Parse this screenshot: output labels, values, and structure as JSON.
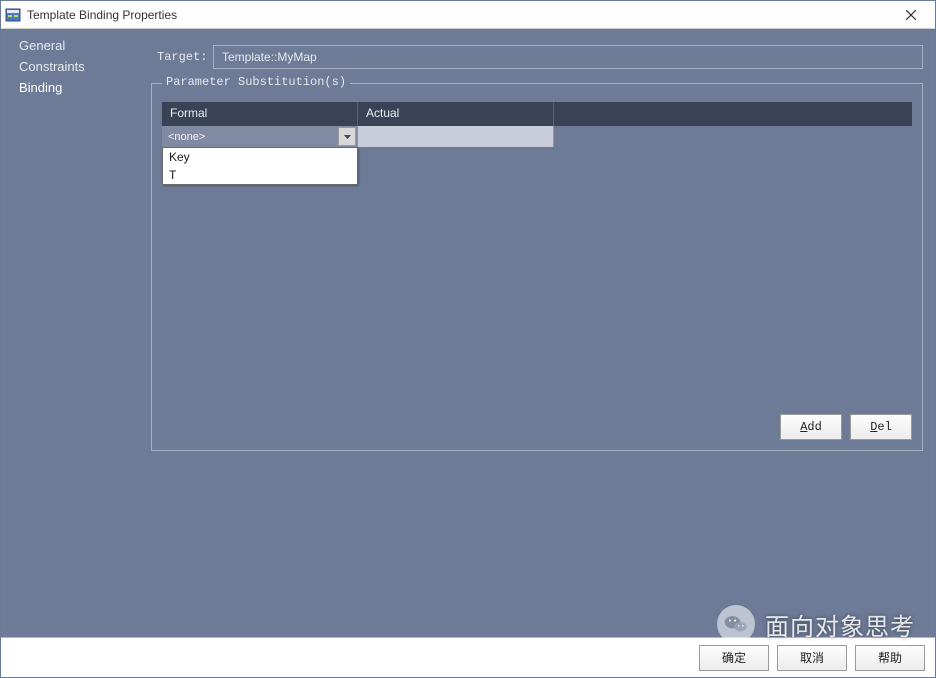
{
  "window": {
    "title": "Template Binding Properties"
  },
  "sidebar": {
    "items": [
      {
        "label": "General",
        "selected": false
      },
      {
        "label": "Constraints",
        "selected": false
      },
      {
        "label": "Binding",
        "selected": true
      }
    ]
  },
  "content": {
    "target_label": "Target:",
    "target_value": "Template::MyMap",
    "group_title": "Parameter Substitution(s)",
    "columns": {
      "formal": "Formal",
      "actual": "Actual"
    },
    "row": {
      "formal_value": "<none>",
      "actual_value": ""
    },
    "dropdown_options": [
      "Key",
      "T"
    ],
    "buttons": {
      "add_prefix": "A",
      "add_rest": "dd",
      "del_prefix": "D",
      "del_rest": "el"
    }
  },
  "footer": {
    "ok": "确定",
    "cancel": "取消",
    "help": "帮助"
  },
  "watermark": {
    "text": "面向对象思考"
  }
}
